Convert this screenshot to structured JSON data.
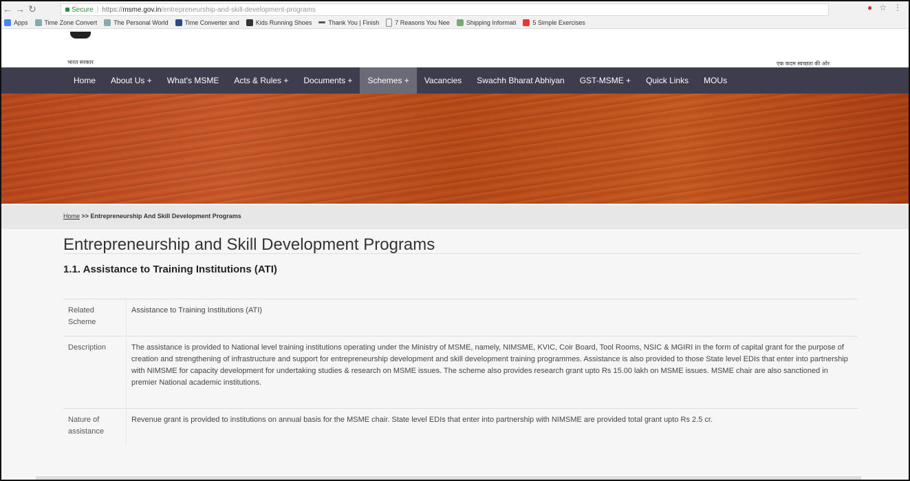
{
  "browser": {
    "secure_label": "Secure",
    "url_scheme": "https://",
    "url_host": "msme.gov.in",
    "url_path": "/entrepreneurship-and-skill-development-programs"
  },
  "bookmarks": [
    {
      "label": "Apps",
      "icon": "apps-grid-icon",
      "color": "#4285f4"
    },
    {
      "label": "Time Zone Convert",
      "icon": "arrows-icon",
      "color": "#8aa"
    },
    {
      "label": "The Personal World",
      "icon": "arrows-icon",
      "color": "#8aa"
    },
    {
      "label": "Time Converter and",
      "icon": "square-icon",
      "color": "#2a4a8a"
    },
    {
      "label": "Kids Running Shoes",
      "icon": "h-icon",
      "color": "#333"
    },
    {
      "label": "Thank You | Finish",
      "icon": "bar-icon",
      "color": "#555"
    },
    {
      "label": "7 Reasons You Nee",
      "icon": "page-icon",
      "color": "#888"
    },
    {
      "label": "Shipping Informati",
      "icon": "chart-icon",
      "color": "#7a7"
    },
    {
      "label": "5 Simple Exercises",
      "icon": "youtube-icon",
      "color": "#e53935"
    }
  ],
  "site": {
    "logo_text": "भारत सरकार",
    "tagline": "एक कदम स्वच्छता की ओर"
  },
  "nav": [
    {
      "label": "Home",
      "active": false
    },
    {
      "label": "About Us +",
      "active": false
    },
    {
      "label": "What's MSME",
      "active": false
    },
    {
      "label": "Acts & Rules +",
      "active": false
    },
    {
      "label": "Documents +",
      "active": false
    },
    {
      "label": "Schemes +",
      "active": true
    },
    {
      "label": "Vacancies",
      "active": false
    },
    {
      "label": "Swachh Bharat Abhiyan",
      "active": false
    },
    {
      "label": "GST-MSME +",
      "active": false
    },
    {
      "label": "Quick Links",
      "active": false
    },
    {
      "label": "MOUs",
      "active": false
    }
  ],
  "breadcrumb": {
    "home": "Home",
    "separator": " >> ",
    "current": "Entrepreneurship And Skill Development Programs"
  },
  "page_title": "Entrepreneurship and Skill Development Programs",
  "section_heading": "1.1. Assistance to Training Institutions (ATI)",
  "table": [
    {
      "label": "Related Scheme",
      "value": "Assistance to Training Institutions (ATI)"
    },
    {
      "label": "Description",
      "value": "The assistance is provided to National level training institutions operating under the Ministry of MSME, namely, NIMSME, KVIC, Coir Board, Tool Rooms, NSIC & MGIRI in the form of capital grant for the purpose of creation and strengthening of infrastructure and support for entrepreneurship development and skill development training programmes. Assistance is also provided to those State level EDIs that enter into partnership with NIMSME for capacity development for undertaking studies & research on MSME issues. The scheme also provides research grant upto Rs 15.00 lakh on MSME issues. MSME chair are also sanctioned in premier National academic institutions."
    },
    {
      "label": "Nature of assistance",
      "value": "Revenue grant is provided to institutions on annual basis for the MSME chair. State level EDIs that enter into partnership with NIMSME are provided total grant upto Rs 2.5 cr."
    }
  ],
  "colors": {
    "nav_bg": "#3d3d4d",
    "nav_active": "#6b6b78",
    "banner": "#b5431a",
    "secure_green": "#2b8a3e"
  }
}
